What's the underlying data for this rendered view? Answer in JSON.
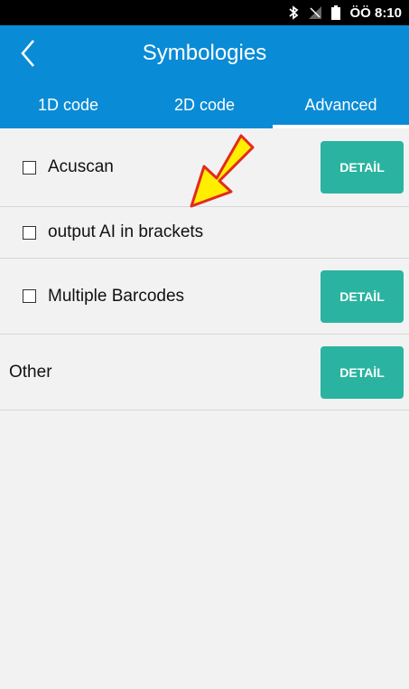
{
  "status_bar": {
    "time": "ÖÖ 8:10",
    "icons": [
      "bluetooth-icon",
      "no-signal-icon",
      "battery-icon"
    ]
  },
  "app_bar": {
    "back_icon": "chevron-left-icon",
    "title": "Symbologies"
  },
  "tabs": [
    {
      "label": "1D code",
      "active": false
    },
    {
      "label": "2D code",
      "active": false
    },
    {
      "label": "Advanced",
      "active": true
    }
  ],
  "rows": [
    {
      "label": "Acuscan",
      "checked": false,
      "detail_label": "DETAİL"
    },
    {
      "label": "output AI in brackets",
      "checked": false
    },
    {
      "label": "Multiple Barcodes",
      "checked": false,
      "detail_label": "DETAİL"
    },
    {
      "label": "Other",
      "detail_label": "DETAİL"
    }
  ],
  "colors": {
    "primary": "#0a8bd6",
    "accent": "#2ab3a0",
    "background": "#f2f2f2",
    "annotation_arrow": "#ffee00"
  }
}
